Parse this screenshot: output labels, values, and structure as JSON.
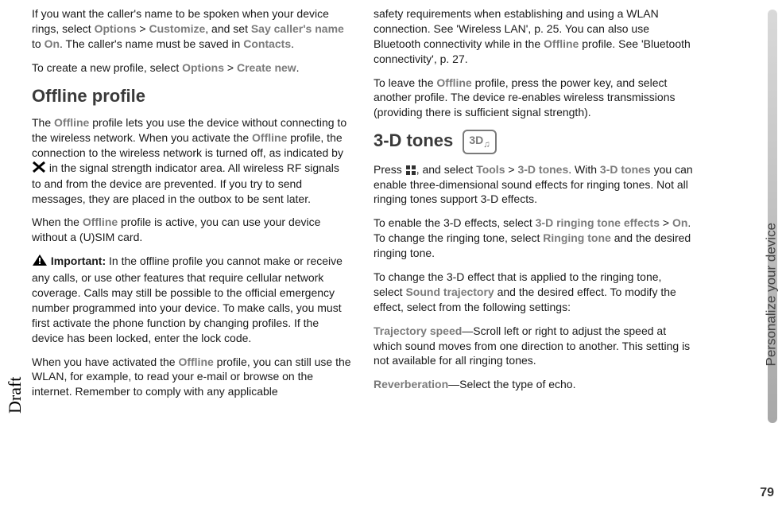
{
  "sideTab": "Personalize your device",
  "draftLabel": "Draft",
  "pageNumber": "79",
  "left": {
    "p1_a": "If you want the caller's name to be spoken when your device rings, select ",
    "p1_opt": "Options",
    "p1_gt1": " > ",
    "p1_cust": "Customize",
    "p1_b": ", and set ",
    "p1_say": "Say caller's name",
    "p1_c": " to ",
    "p1_on": "On",
    "p1_d": ". The caller's name must be saved in ",
    "p1_contacts": "Contacts",
    "p1_e": ".",
    "p2_a": "To create a new profile, select ",
    "p2_opt": "Options",
    "p2_gt": " > ",
    "p2_new": "Create new",
    "p2_b": ".",
    "h_offline": "Offline profile",
    "p3_a": "The ",
    "p3_off": "Offline",
    "p3_b": " profile lets you use the device without connecting to the wireless network. When you activate the ",
    "p3_off2": "Offline",
    "p3_c": " profile, the connection to the wireless network is turned off, as indicated by ",
    "p3_d": " in the signal strength indicator area. All wireless RF signals to and from the device are prevented. If you try to send messages, they are placed in the outbox to be sent later.",
    "p4_a": "When the ",
    "p4_off": "Offline",
    "p4_b": " profile is active, you can use your device without a (U)SIM card.",
    "p5_imp": " Important:",
    "p5_a": " In the offline profile you cannot make or receive any calls, or use other features that require cellular network coverage. Calls may still be possible to the official emergency number programmed into your device. To make calls, you must first activate the phone function by changing profiles. If the device has been locked, enter the lock code.",
    "p6_a": "When you have activated the ",
    "p6_off": "Offline",
    "p6_b": " profile, you can still use the WLAN, for example, to read your e-mail or browse on the internet. Remember to comply with any applicable"
  },
  "right": {
    "p1_a": "safety requirements when establishing and using a WLAN connection. See 'Wireless LAN', p. 25. You can also use Bluetooth connectivity while in the ",
    "p1_off": "Offline",
    "p1_b": " profile. See 'Bluetooth connectivity', p. 27.",
    "p2_a": "To leave the ",
    "p2_off": "Offline",
    "p2_b": " profile, press the power key, and select another profile. The device re-enables wireless transmissions (providing there is sufficient signal strength).",
    "h_3d": "3-D tones",
    "h_3d_icon": "3D",
    "p3_a": "Press ",
    "p3_b": ", and select ",
    "p3_tools": "Tools",
    "p3_gt": " > ",
    "p3_3dt": "3-D tones",
    "p3_c": ". With ",
    "p3_3dt2": "3-D tones",
    "p3_d": " you can enable three-dimensional sound effects for ringing tones. Not all ringing tones support 3-D effects.",
    "p4_a": "To enable the 3-D effects, select ",
    "p4_eff": "3-D ringing tone effects",
    "p4_gt": " > ",
    "p4_on": "On",
    "p4_b": ". To change the ringing tone, select ",
    "p4_rt": "Ringing tone",
    "p4_c": " and the desired ringing tone.",
    "p5_a": "To change the 3-D effect that is applied to the ringing tone, select ",
    "p5_st": "Sound trajectory",
    "p5_b": " and the desired effect. To modify the effect, select from the following settings:",
    "p6_ts": "Trajectory speed",
    "p6_a": "—Scroll left or right to adjust the speed at which sound moves from one direction to another. This setting is not available for all ringing tones.",
    "p7_rev": "Reverberation",
    "p7_a": "—Select the type of echo."
  }
}
